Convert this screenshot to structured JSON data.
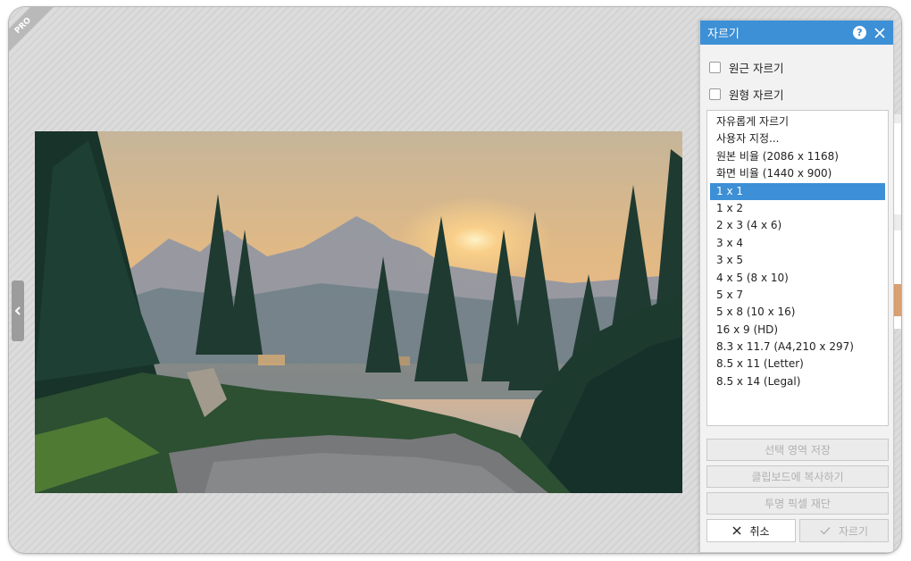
{
  "badge": {
    "label": "PRO"
  },
  "panel": {
    "title": "자르기",
    "help_icon": "?",
    "options": [
      {
        "label": "원근 자르기",
        "checked": false
      },
      {
        "label": "원형 자르기",
        "checked": false
      }
    ],
    "ratios": [
      "자유롭게 자르기",
      "사용자 지정...",
      "원본 비율 (2086 x 1168)",
      "화면 비율 (1440 x 900)",
      "1 x 1",
      "1 x 2",
      "2 x 3 (4 x 6)",
      "3 x 4",
      "3 x 5",
      "4 x 5 (8 x 10)",
      "5 x 7",
      "5 x 8 (10 x 16)",
      "16 x 9 (HD)",
      "8.3 x 11.7 (A4,210 x 297)",
      "8.5 x 11 (Letter)",
      "8.5 x 14 (Legal)"
    ],
    "selected_ratio": "1 x 1",
    "save_selection_label": "선택 영역 저장",
    "copy_clipboard_label": "클립보드에 복사하기",
    "trim_transparent_label": "투명 픽셀 재단",
    "cancel_label": "취소",
    "crop_label": "자르기"
  },
  "colors": {
    "accent": "#3d8fd6",
    "disabled_text": "#b0b0b0"
  },
  "icons": [
    "close-icon",
    "help-icon",
    "chevron-left-icon",
    "x-icon",
    "checkmark-icon"
  ]
}
